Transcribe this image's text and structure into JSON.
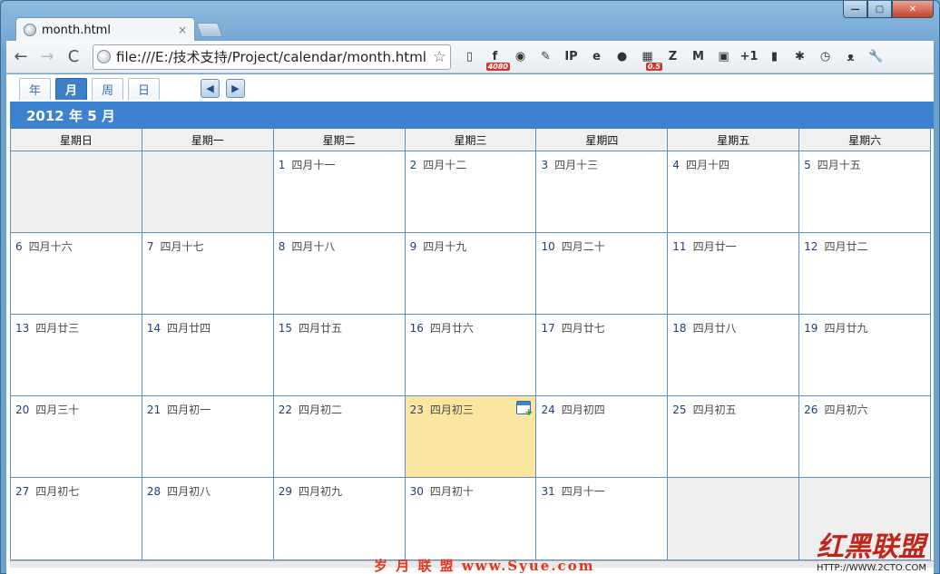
{
  "browser": {
    "tab_title": "month.html",
    "tab_close": "×",
    "url": "file:///E:/技术支持/Project/calendar/month.html",
    "window_controls": {
      "minimize": "—",
      "maximize": "▢",
      "close": "✕"
    },
    "nav": {
      "back": "←",
      "forward": "→",
      "reload": "C",
      "star": "☆"
    },
    "extensions": [
      {
        "name": "reader-icon",
        "glyph": "▯"
      },
      {
        "name": "facebook-icon",
        "glyph": "f",
        "badge": "4080"
      },
      {
        "name": "camera-icon",
        "glyph": "◉"
      },
      {
        "name": "edit-icon",
        "glyph": "✎"
      },
      {
        "name": "ip-icon",
        "glyph": "IP"
      },
      {
        "name": "ie-icon",
        "glyph": "e"
      },
      {
        "name": "record-icon",
        "glyph": "●"
      },
      {
        "name": "grid-icon",
        "glyph": "▦",
        "badge": "0.5"
      },
      {
        "name": "zotero-icon",
        "glyph": "Z"
      },
      {
        "name": "gmail-icon",
        "glyph": "M"
      },
      {
        "name": "calendar-ext-icon",
        "glyph": "▣"
      },
      {
        "name": "google-plus-icon",
        "glyph": "+1"
      },
      {
        "name": "battery-icon",
        "glyph": "▮"
      },
      {
        "name": "bug-icon",
        "glyph": "✱"
      },
      {
        "name": "timer-icon",
        "glyph": "◷"
      },
      {
        "name": "cat-icon",
        "glyph": "ᴥ"
      },
      {
        "name": "wrench-icon",
        "glyph": "🔧"
      }
    ]
  },
  "calendar": {
    "views": [
      "年",
      "月",
      "周",
      "日"
    ],
    "active_view": "月",
    "prev_arrow": "◀",
    "next_arrow": "▶",
    "month_title": "2012 年 5 月",
    "weekdays": [
      "星期日",
      "星期一",
      "星期二",
      "星期三",
      "星期四",
      "星期五",
      "星期六"
    ],
    "weeks": [
      [
        {
          "empty": true
        },
        {
          "empty": true
        },
        {
          "day": "1",
          "lunar": "四月十一"
        },
        {
          "day": "2",
          "lunar": "四月十二"
        },
        {
          "day": "3",
          "lunar": "四月十三"
        },
        {
          "day": "4",
          "lunar": "四月十四"
        },
        {
          "day": "5",
          "lunar": "四月十五"
        }
      ],
      [
        {
          "day": "6",
          "lunar": "四月十六"
        },
        {
          "day": "7",
          "lunar": "四月十七"
        },
        {
          "day": "8",
          "lunar": "四月十八"
        },
        {
          "day": "9",
          "lunar": "四月十九"
        },
        {
          "day": "10",
          "lunar": "四月二十"
        },
        {
          "day": "11",
          "lunar": "四月廿一"
        },
        {
          "day": "12",
          "lunar": "四月廿二"
        }
      ],
      [
        {
          "day": "13",
          "lunar": "四月廿三"
        },
        {
          "day": "14",
          "lunar": "四月廿四"
        },
        {
          "day": "15",
          "lunar": "四月廿五"
        },
        {
          "day": "16",
          "lunar": "四月廿六"
        },
        {
          "day": "17",
          "lunar": "四月廿七"
        },
        {
          "day": "18",
          "lunar": "四月廿八"
        },
        {
          "day": "19",
          "lunar": "四月廿九"
        }
      ],
      [
        {
          "day": "20",
          "lunar": "四月三十"
        },
        {
          "day": "21",
          "lunar": "四月初一"
        },
        {
          "day": "22",
          "lunar": "四月初二"
        },
        {
          "day": "23",
          "lunar": "四月初三",
          "today": true
        },
        {
          "day": "24",
          "lunar": "四月初四"
        },
        {
          "day": "25",
          "lunar": "四月初五"
        },
        {
          "day": "26",
          "lunar": "四月初六"
        }
      ],
      [
        {
          "day": "27",
          "lunar": "四月初七"
        },
        {
          "day": "28",
          "lunar": "四月初八"
        },
        {
          "day": "29",
          "lunar": "四月初九"
        },
        {
          "day": "30",
          "lunar": "四月初十"
        },
        {
          "day": "31",
          "lunar": "四月十一"
        },
        {
          "empty": true
        },
        {
          "empty": true
        }
      ]
    ]
  },
  "watermarks": {
    "site_cn": "岁 月 联 盟  www.Syue.com",
    "logo": "红黑联盟",
    "url": "HTTP://WWW.2CTO.COM"
  },
  "colors": {
    "accent": "#3c82cf",
    "today": "#fae6a0",
    "grid_line": "#5d8fc4"
  }
}
